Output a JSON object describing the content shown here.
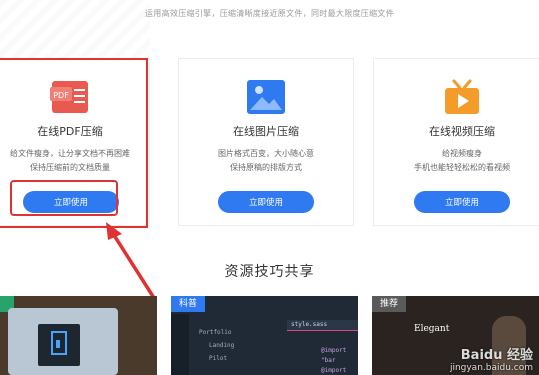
{
  "header": {
    "subtitle": "运用高效压缩引擎，压缩清晰度接近原文件，同时最大限度压缩文件"
  },
  "cards": [
    {
      "title": "在线PDF压缩",
      "desc_line1": "给文件瘦身，让分享文档不再困难",
      "desc_line2": "保持压缩前的文档质量",
      "button": "立即使用",
      "icon_text": "PDF",
      "icon": "pdf-icon",
      "color": "#e85a4f"
    },
    {
      "title": "在线图片压缩",
      "desc_line1": "图片格式百变，大小随心意",
      "desc_line2": "保持原稿的排版方式",
      "button": "立即使用",
      "icon": "image-icon",
      "color": "#2f7af0"
    },
    {
      "title": "在线视频压缩",
      "desc_line1": "给视频瘦身",
      "desc_line2": "手机也能轻轻松松的看视频",
      "button": "立即使用",
      "icon": "video-icon",
      "color": "#f59b2a"
    }
  ],
  "section": {
    "title": "资源技巧共享"
  },
  "thumbnails": [
    {
      "tag": "",
      "icon": "laptop-icon"
    },
    {
      "tag": "科普",
      "editor": {
        "folder": "Portfolio",
        "sub1": "Landing",
        "sub2": "Pilot",
        "tab": "style.sass",
        "code1": "@import \"bar",
        "code2": "@import \"dis"
      }
    },
    {
      "tag": "推荐",
      "text": "Elegant"
    }
  ],
  "watermark": {
    "brand": "Baidu 经验",
    "url": "jingyan.baidu.com"
  },
  "colors": {
    "accent": "#2f7af0",
    "highlight": "#e03232"
  }
}
